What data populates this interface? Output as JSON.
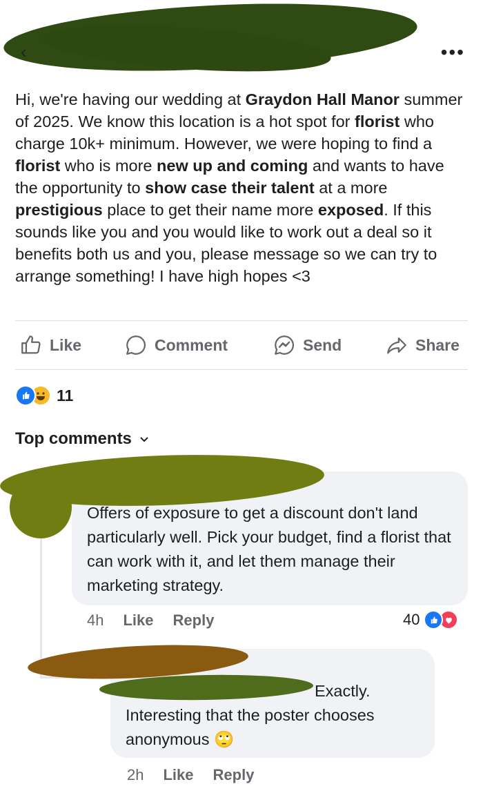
{
  "header": {
    "more_label": "•••",
    "back_label": "‹"
  },
  "post": {
    "segments": [
      {
        "t": "Hi, we're having our wedding at ",
        "b": false
      },
      {
        "t": "Graydon Hall Manor",
        "b": true
      },
      {
        "t": " summer of 2025. We know this location is a hot spot for ",
        "b": false
      },
      {
        "t": "florist",
        "b": true
      },
      {
        "t": " who charge 10k+ minimum. However, we were hoping to find a ",
        "b": false
      },
      {
        "t": "florist",
        "b": true
      },
      {
        "t": " who is more ",
        "b": false
      },
      {
        "t": "new up and coming",
        "b": true
      },
      {
        "t": " and wants to have the opportunity to ",
        "b": false
      },
      {
        "t": "show case their talent",
        "b": true
      },
      {
        "t": " at a more ",
        "b": false
      },
      {
        "t": "prestigious",
        "b": true
      },
      {
        "t": " place to get their name more ",
        "b": false
      },
      {
        "t": "exposed",
        "b": true
      },
      {
        "t": ". If this sounds like you and you would like to work out a deal so it benefits both us and you, please message so we can try to arrange something! I have high hopes <3",
        "b": false
      }
    ]
  },
  "actions": {
    "like": "Like",
    "comment": "Comment",
    "send": "Send",
    "share": "Share"
  },
  "reactions": {
    "count": "11",
    "like_color": "#1877f2",
    "haha_color": "#f7b928"
  },
  "comments_header": "Top comments",
  "comments": [
    {
      "text": "Offers of exposure to get a discount don't land particularly well. Pick your budget, find a florist that can work with it, and let them manage their marketing strategy.",
      "time": "4h",
      "like": "Like",
      "reply": "Reply",
      "reaction_count": "40"
    },
    {
      "text_line1": "Exactly.",
      "text_rest": "Interesting that the poster chooses anonymous",
      "emoji": "🙄",
      "time": "2h",
      "like": "Like",
      "reply": "Reply"
    }
  ],
  "colors": {
    "redaction_dark": "#2f4a12",
    "redaction_olive": "#6f7d12",
    "redaction_brown": "#8a5a10",
    "meta_gray": "#65676b"
  }
}
